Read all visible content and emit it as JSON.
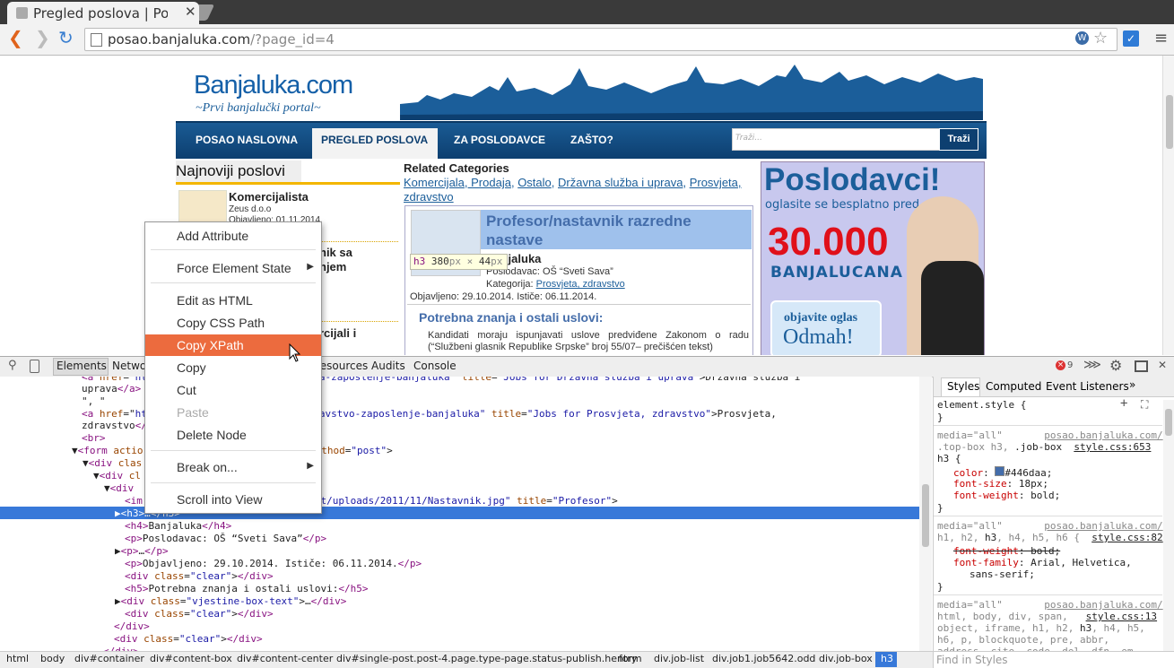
{
  "browser": {
    "tab_title": "Pregled poslova | Po",
    "url_host": "posao.banjaluka.com",
    "url_path": "/?page_id=4"
  },
  "site": {
    "logo_text": "Banjaluka.com",
    "logo_tagline": "~Prvi banjalučki portal~",
    "nav": [
      "POSAO NASLOVNA",
      "PREGLED POSLOVA",
      "ZA POSLODAVCE",
      "ZAŠTO?"
    ],
    "search_placeholder": "Traži...",
    "search_button": "Traži",
    "left_heading": "Najnoviji poslovi",
    "jobs": [
      {
        "title": "Komercijalista",
        "company": "Zeus d.o.o",
        "date": "Objavljeno: 01.11.2014."
      },
      {
        "title": "nik sa",
        "title2": "njem"
      },
      {
        "title": "rcijali i"
      }
    ],
    "related_heading": "Related Categories",
    "related_links": [
      "Komercijala, Prodaja",
      "Ostalo",
      "Državna služba i uprava",
      "Prosvjeta, zdravstvo"
    ],
    "job_detail": {
      "title": "Profesor/nastavnik razredne nastave",
      "city": "Banjaluka",
      "employer": "Poslodavac: OŠ “Sveti Sava”",
      "category_label": "Kategorija:",
      "category": "Prosvjeta, zdravstvo",
      "dates": "Objavljeno: 29.10.2014. Ističe: 06.11.2014.",
      "section": "Potrebna znanja i ostali uslovi:",
      "text": "Kandidati moraju ispunjavati uslove predviđene Zakonom o radu (“Službeni glasnik Republike Srpske” broj 55/07– prečišćen tekst)"
    },
    "banner": {
      "title": "Poslodavci!",
      "subtitle": "oglasite se besplatno pred",
      "number": "30.000",
      "word": "BANJALUCANA",
      "cta1": "objavite oglas",
      "cta2": "Odmah!"
    }
  },
  "tooltip": {
    "tag": "h3",
    "width": "380",
    "height": "44",
    "unit": "px",
    "times": "×"
  },
  "devtools": {
    "tabs": [
      "Elements",
      "Netwo",
      "Resources",
      "Audits",
      "Console"
    ],
    "error_count": "9",
    "styles_tabs": [
      "Styles",
      "Computed",
      "Event Listeners"
    ],
    "find_placeholder": "Find in Styles",
    "breadcrumbs": [
      "html",
      "body",
      "div#container",
      "div#content-box",
      "div#content-center",
      "div#single-post.post-4.page.type-page.status-publish.hentry",
      "form",
      "div.job-list",
      "div.job1.job5642.odd",
      "div.job-box",
      "h3"
    ]
  },
  "context_menu": {
    "items": [
      "Add Attribute",
      "Force Element State",
      "Edit as HTML",
      "Copy CSS Path",
      "Copy XPath",
      "Copy",
      "Cut",
      "Paste",
      "Delete Node",
      "Break on...",
      "Scroll into View"
    ],
    "highlighted": "Copy XPath"
  },
  "colors": {
    "accent": "#ec6b3e",
    "nav_blue": "#0d3f70",
    "selection": "#3879d9",
    "job_title": "#446daa"
  }
}
